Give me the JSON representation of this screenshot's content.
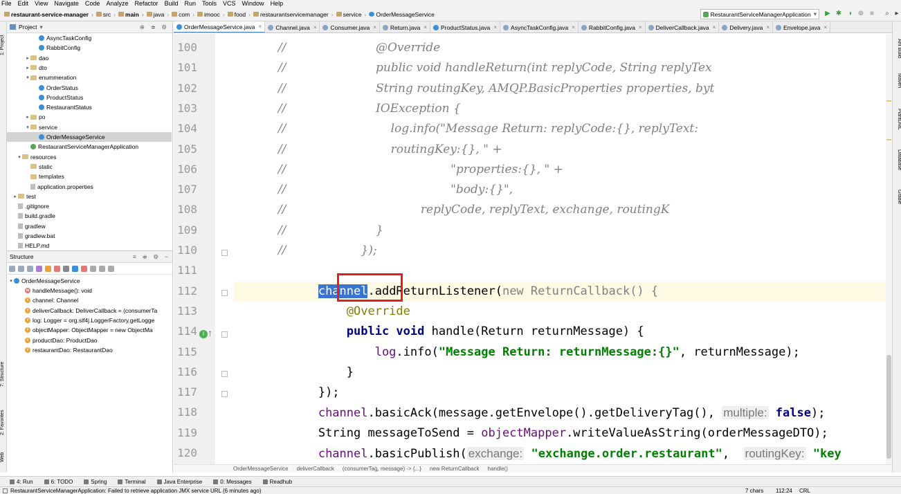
{
  "menu": [
    "File",
    "Edit",
    "View",
    "Navigate",
    "Code",
    "Analyze",
    "Refactor",
    "Build",
    "Run",
    "Tools",
    "VCS",
    "Window",
    "Help"
  ],
  "breadcrumbs": [
    "restaurant-service-manager",
    "src",
    "main",
    "java",
    "com",
    "imooc",
    "food",
    "restaurantservicemanager",
    "service",
    "OrderMessageService"
  ],
  "run_config": "RestaurantServiceManagerApplication",
  "left_tabs": [
    "1: Project",
    "7: Structure",
    "2: Favorites",
    "Web"
  ],
  "right_tabs": [
    "Ant Build",
    "Maven",
    "PlantUML",
    "Database",
    "Gradle"
  ],
  "project": {
    "title": "Project",
    "tree": [
      {
        "label": "AsyncTaskConfig",
        "icon": "class",
        "indent": 6
      },
      {
        "label": "RabbitConfig",
        "icon": "class",
        "indent": 6
      },
      {
        "label": "dao",
        "icon": "folder",
        "indent": 4,
        "arrow": "▸"
      },
      {
        "label": "dto",
        "icon": "folder",
        "indent": 4,
        "arrow": "▸"
      },
      {
        "label": "enummeration",
        "icon": "folder",
        "indent": 4,
        "arrow": "▾"
      },
      {
        "label": "OrderStatus",
        "icon": "class",
        "indent": 6
      },
      {
        "label": "ProductStatus",
        "icon": "class",
        "indent": 6
      },
      {
        "label": "RestaurantStatus",
        "icon": "class",
        "indent": 6
      },
      {
        "label": "po",
        "icon": "folder",
        "indent": 4,
        "arrow": "▸"
      },
      {
        "label": "service",
        "icon": "folder",
        "indent": 4,
        "arrow": "▾"
      },
      {
        "label": "OrderMessageService",
        "icon": "class",
        "indent": 6,
        "selected": true
      },
      {
        "label": "RestaurantServiceManagerApplication",
        "icon": "class-green",
        "indent": 4
      },
      {
        "label": "resources",
        "icon": "folder",
        "indent": 2,
        "arrow": "▾"
      },
      {
        "label": "static",
        "icon": "folder",
        "indent": 4
      },
      {
        "label": "templates",
        "icon": "folder",
        "indent": 4
      },
      {
        "label": "application.properties",
        "icon": "file",
        "indent": 4
      },
      {
        "label": "test",
        "icon": "folder",
        "indent": 1,
        "arrow": "▸"
      },
      {
        "label": ".gitignore",
        "icon": "file",
        "indent": 1
      },
      {
        "label": "build.gradle",
        "icon": "file",
        "indent": 1
      },
      {
        "label": "gradlew",
        "icon": "file",
        "indent": 1
      },
      {
        "label": "gradlew.bat",
        "icon": "file",
        "indent": 1
      },
      {
        "label": "HELP.md",
        "icon": "file",
        "indent": 1
      }
    ]
  },
  "structure": {
    "title": "Structure",
    "root": "OrderMessageService",
    "members": [
      {
        "badge": "m",
        "label": "handleMessage(): void"
      },
      {
        "badge": "f",
        "label": "channel: Channel"
      },
      {
        "badge": "f",
        "label": "deliverCallback: DeliverCallback = (consumerTa"
      },
      {
        "badge": "f",
        "label": "log: Logger = org.slf4j.LoggerFactory.getLogge"
      },
      {
        "badge": "f",
        "label": "objectMapper: ObjectMapper = new ObjectMa"
      },
      {
        "badge": "f",
        "label": "productDao: ProductDao"
      },
      {
        "badge": "f",
        "label": "restaurantDao: RestaurantDao"
      }
    ]
  },
  "tabs": [
    {
      "label": "OrderMessageService.java",
      "active": true
    },
    {
      "label": "Channel.java"
    },
    {
      "label": "Consumer.java"
    },
    {
      "label": "Return.java"
    },
    {
      "label": "ProductStatus.java"
    },
    {
      "label": "AsyncTaskConfig.java"
    },
    {
      "label": "RabbitConfig.java"
    },
    {
      "label": "DeliverCallback.java"
    },
    {
      "label": "Delivery.java"
    },
    {
      "label": "Envelope.java"
    }
  ],
  "editor": {
    "line_numbers": [
      "100",
      "101",
      "102",
      "103",
      "104",
      "105",
      "106",
      "107",
      "108",
      "109",
      "110",
      "111",
      "112",
      "113",
      "114",
      "115",
      "116",
      "117",
      "118",
      "119",
      "120"
    ],
    "lines": [
      [
        {
          "t": "            //                        ",
          "c": "cm"
        },
        {
          "t": "@Override",
          "c": "cm"
        }
      ],
      [
        {
          "t": "            //                        ",
          "c": "cm"
        },
        {
          "t": "public void handleReturn(int replyCode, String replyTex",
          "c": "cm"
        }
      ],
      [
        {
          "t": "            //                        ",
          "c": "cm"
        },
        {
          "t": "String routingKey, AMQP.BasicProperties properties, byt",
          "c": "cm"
        }
      ],
      [
        {
          "t": "            //                        ",
          "c": "cm"
        },
        {
          "t": "IOException {",
          "c": "cm"
        }
      ],
      [
        {
          "t": "            //                            ",
          "c": "cm"
        },
        {
          "t": "log.info(\"Message Return: replyCode:{}, replyText:",
          "c": "cm"
        }
      ],
      [
        {
          "t": "            //                            ",
          "c": "cm"
        },
        {
          "t": "routingKey:{}, \" +",
          "c": "cm"
        }
      ],
      [
        {
          "t": "            //                                            ",
          "c": "cm"
        },
        {
          "t": "\"properties:{}, \" +",
          "c": "cm"
        }
      ],
      [
        {
          "t": "            //                                            ",
          "c": "cm"
        },
        {
          "t": "\"body:{}\",",
          "c": "cm"
        }
      ],
      [
        {
          "t": "            //                                    ",
          "c": "cm"
        },
        {
          "t": "replyCode, replyText, exchange, routingK",
          "c": "cm"
        }
      ],
      [
        {
          "t": "            //                        ",
          "c": "cm"
        },
        {
          "t": "}",
          "c": "cm"
        }
      ],
      [
        {
          "t": "            //                    ",
          "c": "cm"
        },
        {
          "t": "});",
          "c": "cm"
        }
      ],
      [],
      [
        {
          "t": "            ",
          "c": ""
        },
        {
          "t": "channel",
          "c": "selword"
        },
        {
          "t": ".addReturnListener(",
          "c": ""
        },
        {
          "t": "new ",
          "c": "gr"
        },
        {
          "t": "ReturnCallback() {",
          "c": "gr"
        }
      ],
      [
        {
          "t": "                ",
          "c": ""
        },
        {
          "t": "@Override",
          "c": "an"
        }
      ],
      [
        {
          "t": "                ",
          "c": ""
        },
        {
          "t": "public void ",
          "c": "kw"
        },
        {
          "t": "handle(Return returnMessage) {",
          "c": ""
        }
      ],
      [
        {
          "t": "                    ",
          "c": ""
        },
        {
          "t": "log",
          "c": "fd"
        },
        {
          "t": ".info(",
          "c": ""
        },
        {
          "t": "\"Message Return: returnMessage:{}\"",
          "c": "st"
        },
        {
          "t": ", returnMessage);",
          "c": ""
        }
      ],
      [
        {
          "t": "                ",
          "c": ""
        },
        {
          "t": "}",
          "c": ""
        }
      ],
      [
        {
          "t": "            ",
          "c": ""
        },
        {
          "t": "});",
          "c": ""
        }
      ],
      [
        {
          "t": "            ",
          "c": ""
        },
        {
          "t": "channel",
          "c": "fd"
        },
        {
          "t": ".basicAck(message.getEnvelope().getDeliveryTag(), ",
          "c": ""
        },
        {
          "t": "multiple:",
          "c": "hint"
        },
        {
          "t": " false",
          "c": "kw"
        },
        {
          "t": ");",
          "c": ""
        }
      ],
      [
        {
          "t": "            ",
          "c": ""
        },
        {
          "t": "String messageToSend = ",
          "c": ""
        },
        {
          "t": "objectMapper",
          "c": "fd"
        },
        {
          "t": ".writeValueAsString(orderMessageDTO);",
          "c": ""
        }
      ],
      [
        {
          "t": "            ",
          "c": ""
        },
        {
          "t": "channel",
          "c": "fd"
        },
        {
          "t": ".basicPublish(",
          "c": ""
        },
        {
          "t": "exchange:",
          "c": "hint"
        },
        {
          "t": " \"exchange.order.restaurant\"",
          "c": "st"
        },
        {
          "t": ",  ",
          "c": ""
        },
        {
          "t": "routingKey:",
          "c": "hint"
        },
        {
          "t": " \"key",
          "c": "st"
        }
      ]
    ]
  },
  "editor_breadcrumb": [
    "OrderMessageService",
    "deliverCallback",
    "(consumerTag, message) -> {...}",
    "new ReturnCallback",
    "handle()"
  ],
  "bottom_tabs": [
    "4: Run",
    "6: TODO",
    "Spring",
    "Terminal",
    "Java Enterprise",
    "0: Messages",
    "Readhub"
  ],
  "status": {
    "message": "RestaurantServiceManagerApplication: Failed to retrieve application JMX service URL (6 minutes ago)",
    "chars": "7 chars",
    "position": "112:24",
    "line_sep": "CRL"
  }
}
